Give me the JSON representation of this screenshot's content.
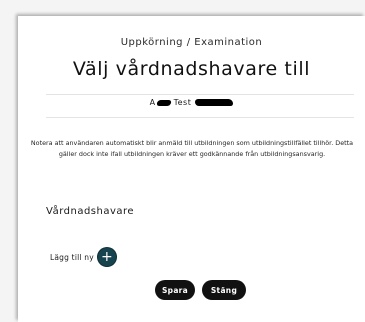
{
  "modal": {
    "subtitle": "Uppkörning / Examination",
    "title": "Välj vårdnadshavare till",
    "user": {
      "first": "A",
      "middle": "Test"
    },
    "notice": "Notera att användaren automatiskt blir anmäld till utbildningen som utbildningstillfället tillhör. Detta gäller dock inte ifall utbildningen kräver ett godkännande från utbildningsansvarig.",
    "section_title": "Vårdnadshavare",
    "add_label": "Lägg till ny",
    "add_icon": "plus-icon",
    "buttons": {
      "save": "Spara",
      "close": "Stäng"
    }
  },
  "colors": {
    "accent": "#17434f",
    "button_bg": "#111111",
    "button_text": "#ffffff"
  }
}
